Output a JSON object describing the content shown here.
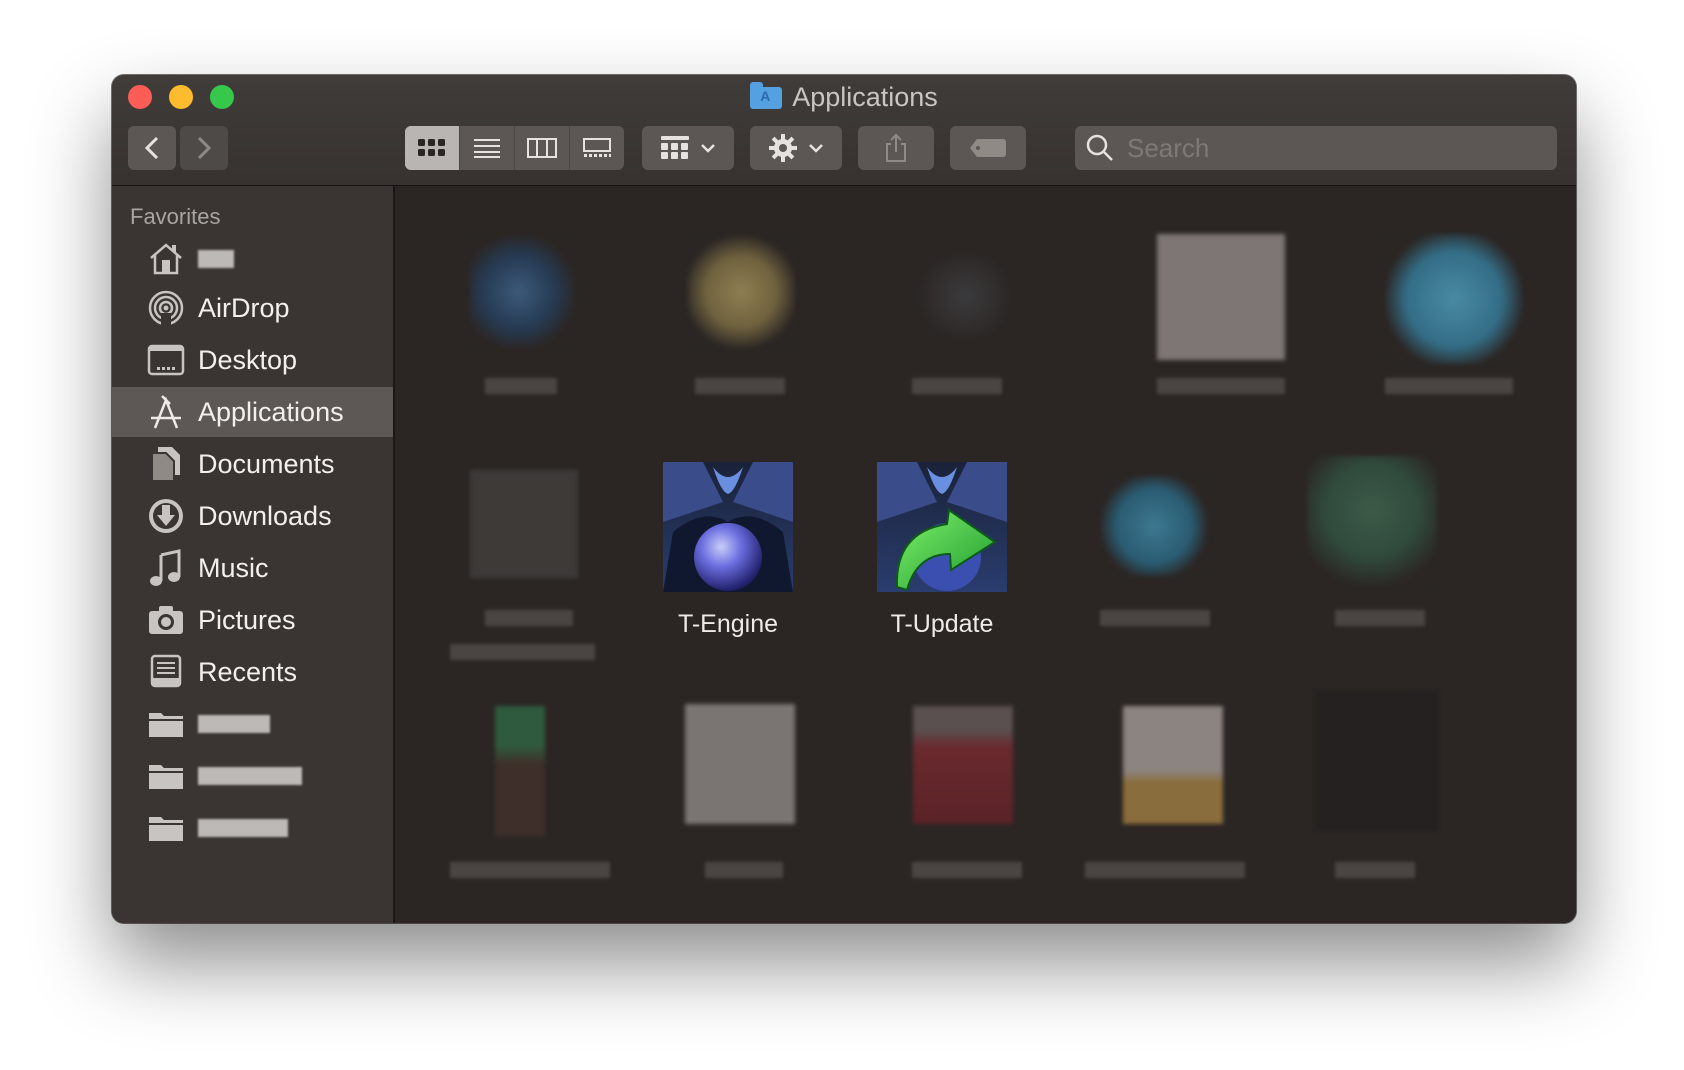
{
  "window": {
    "title": "Applications"
  },
  "toolbar": {
    "back_label": "<",
    "forward_label": ">",
    "search_placeholder": "Search",
    "view_modes": [
      "icon",
      "list",
      "column",
      "gallery"
    ],
    "active_view": "icon"
  },
  "sidebar": {
    "heading": "Favorites",
    "items": [
      {
        "label": "",
        "icon": "home-icon",
        "redacted": true
      },
      {
        "label": "AirDrop",
        "icon": "airdrop-icon"
      },
      {
        "label": "Desktop",
        "icon": "desktop-icon"
      },
      {
        "label": "Applications",
        "icon": "applications-icon",
        "selected": true
      },
      {
        "label": "Documents",
        "icon": "documents-icon"
      },
      {
        "label": "Downloads",
        "icon": "downloads-icon"
      },
      {
        "label": "Music",
        "icon": "music-icon"
      },
      {
        "label": "Pictures",
        "icon": "pictures-icon"
      },
      {
        "label": "Recents",
        "icon": "recents-icon"
      },
      {
        "label": "",
        "icon": "folder-icon",
        "redacted": true
      },
      {
        "label": "",
        "icon": "folder-icon",
        "redacted": true
      },
      {
        "label": "",
        "icon": "folder-icon",
        "redacted": true
      }
    ]
  },
  "content": {
    "apps": [
      {
        "label": "T-Engine",
        "icon": "t-engine-icon"
      },
      {
        "label": "T-Update",
        "icon": "t-update-icon"
      }
    ]
  },
  "colors": {
    "close": "#fc5e57",
    "minimize": "#fdbc2e",
    "maximize": "#35c84a",
    "sidebar_bg": "#3a3533",
    "content_bg": "#2b2624",
    "selection": "#5d5856"
  }
}
